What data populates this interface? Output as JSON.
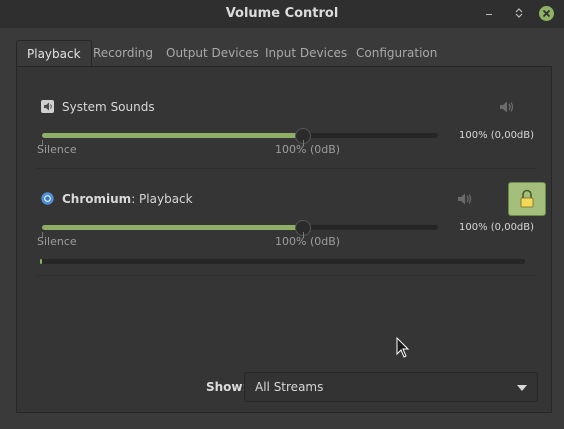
{
  "window": {
    "title": "Volume Control"
  },
  "tabs": [
    {
      "label": "Playback",
      "active": true
    },
    {
      "label": "Recording",
      "active": false
    },
    {
      "label": "Output Devices",
      "active": false
    },
    {
      "label": "Input Devices",
      "active": false
    },
    {
      "label": "Configuration",
      "active": false
    }
  ],
  "streams": [
    {
      "name": "System Sounds",
      "icon": "speaker-icon",
      "volume_fraction": 0.66,
      "volume_text": "100% (0,00dB)",
      "left_label": "Silence",
      "mid_label": "100% (0dB)"
    },
    {
      "app_name": "Chromium",
      "stream_suffix": ": Playback",
      "icon": "chromium-icon",
      "volume_fraction": 0.66,
      "volume_text": "100% (0,00dB)",
      "left_label": "Silence",
      "mid_label": "100% (0dB)",
      "lock_channels": true,
      "level_fraction": 0.004
    }
  ],
  "footer": {
    "show_label": "Show:",
    "show_value": "All Streams"
  },
  "colors": {
    "accent": "#8fae66",
    "background": "#3a3a3a",
    "panel": "#353535"
  }
}
